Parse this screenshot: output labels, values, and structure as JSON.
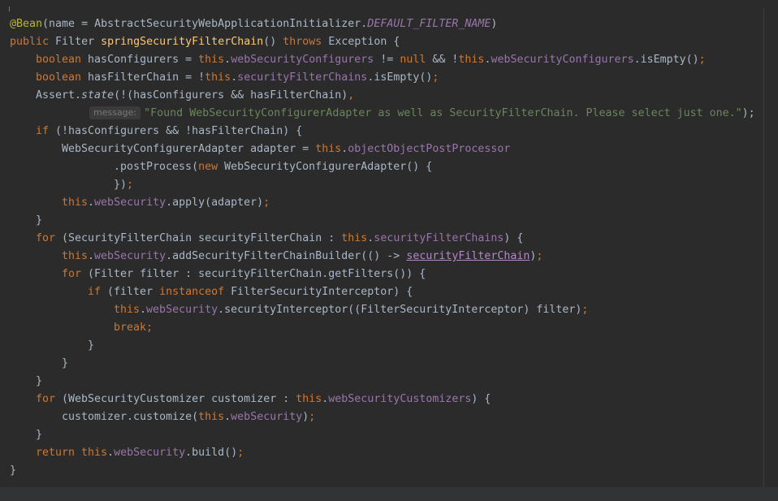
{
  "editor": {
    "lines": [
      [
        "@Bean",
        "(name = AbstractSecurityWebApplicationInitializer.",
        "DEFAULT_FILTER_NAME",
        ")"
      ],
      [
        "public ",
        "Filter ",
        "springSecurityFilterChain",
        "() ",
        "throws ",
        "Exception {"
      ],
      [
        "boolean ",
        "hasConfigurers = ",
        "this",
        ".",
        "webSecurityConfigurers",
        " != ",
        "null",
        " && !",
        "this",
        ".",
        "webSecurityConfigurers",
        ".isEmpty()",
        ";"
      ],
      [
        "boolean ",
        "hasFilterChain = !",
        "this",
        ".",
        "securityFilterChains",
        ".isEmpty()",
        ";"
      ],
      [
        "Assert.",
        "state",
        "(!(hasConfigurers && hasFilterChain)",
        ","
      ],
      [
        "message:",
        "\"Found WebSecurityConfigurerAdapter as well as SecurityFilterChain. Please select just one.\"",
        ");"
      ],
      [
        "if ",
        "(!hasConfigurers && !hasFilterChain) {"
      ],
      [
        "WebSecurityConfigurerAdapter adapter = ",
        "this",
        ".",
        "objectObjectPostProcessor"
      ],
      [
        ".postProcess(",
        "new ",
        "WebSecurityConfigurerAdapter() {"
      ],
      [
        "})",
        ";"
      ],
      [
        "this",
        ".",
        "webSecurity",
        ".apply(adapter)",
        ";"
      ],
      [
        "}"
      ],
      [
        "for ",
        "(SecurityFilterChain securityFilterChain : ",
        "this",
        ".",
        "securityFilterChains",
        ") {"
      ],
      [
        "this",
        ".",
        "webSecurity",
        ".addSecurityFilterChainBuilder(() -> ",
        "securityFilterChain",
        ")",
        ";"
      ],
      [
        "for ",
        "(Filter filter : securityFilterChain.getFilters()) {"
      ],
      [
        "if ",
        "(filter ",
        "instanceof ",
        "FilterSecurityInterceptor) {"
      ],
      [
        "this",
        ".",
        "webSecurity",
        ".securityInterceptor((FilterSecurityInterceptor) filter)",
        ";"
      ],
      [
        "break",
        ";"
      ],
      [
        "}"
      ],
      [
        "}"
      ],
      [
        "}"
      ],
      [
        "for ",
        "(WebSecurityCustomizer customizer : ",
        "this",
        ".",
        "webSecurityCustomizers",
        ") {"
      ],
      [
        "customizer.customize(",
        "this",
        ".",
        "webSecurity",
        ")",
        ";"
      ],
      [
        "}"
      ],
      [
        "return ",
        "this",
        ".",
        "webSecurity",
        ".build()",
        ";"
      ],
      [
        "}"
      ]
    ]
  }
}
